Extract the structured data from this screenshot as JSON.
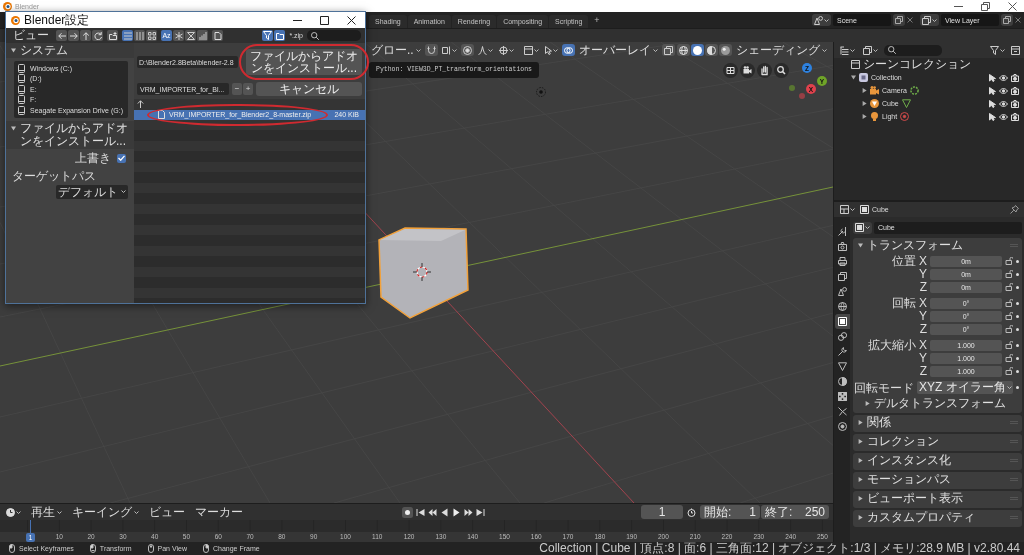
{
  "main_window": {
    "title": "Blender"
  },
  "top_bar": {
    "workspaces": [
      {
        "label": "Shading",
        "selected": false
      },
      {
        "label": "Animation",
        "selected": false
      },
      {
        "label": "Rendering",
        "selected": false
      },
      {
        "label": "Compositing",
        "selected": false
      },
      {
        "label": "Scripting",
        "selected": false
      }
    ],
    "add_workspace": "+",
    "scene": "Scene",
    "view_layer": "View Layer"
  },
  "viewport": {
    "header": {
      "orientation": "グロー..",
      "overlays": {
        "label": "オーバーレイ",
        "on": true
      },
      "shading": {
        "label": "シェーディング",
        "modes": [
          {
            "kind": "wireframe",
            "selected": false
          },
          {
            "kind": "solid",
            "selected": true
          },
          {
            "kind": "material",
            "selected": false
          },
          {
            "kind": "rendered",
            "selected": false
          }
        ]
      }
    },
    "tooltip": "Python: VIEW3D_PT_transform_orientations",
    "axes": [
      {
        "label": "Z",
        "color": "#2e82e0"
      },
      {
        "label": "Y",
        "color": "#6fa428"
      },
      {
        "label": "X",
        "color": "#e0414c"
      }
    ]
  },
  "dialog": {
    "title": "Blender設定",
    "menu": "ビュー",
    "view_modes": [
      {
        "kind": "vertical",
        "selected": true
      },
      {
        "kind": "horizontal",
        "selected": false
      },
      {
        "kind": "thumbnails",
        "selected": false
      }
    ],
    "sort_modes": [
      {
        "kind": "alpha",
        "label": "Az",
        "selected": true
      },
      {
        "kind": "extension",
        "selected": false
      },
      {
        "kind": "time",
        "selected": false
      },
      {
        "kind": "size",
        "selected": false
      }
    ],
    "filter": {
      "on": true,
      "text": "*.zip"
    },
    "sidebar": {
      "system": {
        "title": "システム",
        "expanded": true,
        "drives": [
          "Windows (C:)",
          "(D:)",
          "E:",
          "F:",
          "Seagate Expansion Drive (G:)"
        ]
      },
      "install": {
        "title": "ファイルからアドオンをインストール...",
        "expanded": true,
        "overwrite": {
          "label": "上書き",
          "checked": true
        },
        "target_path": {
          "label": "ターゲットパス",
          "value": "デフォルト"
        }
      }
    },
    "path": "D:\\Blender2.8Beta\\blender-2.8",
    "install_button": "ファイルからアドオンをインストール...",
    "filename": "VRM_IMPORTER_for_Bl...",
    "filename_steps": [
      "−",
      "+"
    ],
    "cancel_button": "キャンセル",
    "files": [
      {
        "kind": "parent",
        "selected": false
      },
      {
        "kind": "file",
        "name": "VRM_IMPORTER_for_Blender2_8-master.zip",
        "size": "240 KiB",
        "selected": true
      }
    ]
  },
  "outliner": {
    "tree": [
      {
        "label": "シーンコレクション",
        "kind": "scene_collection",
        "children": [
          {
            "label": "Collection",
            "kind": "collection",
            "expanded": true,
            "children": [
              {
                "label": "Camera",
                "kind": "camera",
                "expanded": false
              },
              {
                "label": "Cube",
                "kind": "mesh",
                "expanded": false
              },
              {
                "label": "Light",
                "kind": "light",
                "expanded": false
              }
            ]
          }
        ]
      }
    ]
  },
  "properties": {
    "object": "Cube",
    "name": "Cube",
    "tabs": [
      {
        "kind": "tool",
        "selected": false
      },
      {
        "kind": "render",
        "selected": false
      },
      {
        "kind": "output",
        "selected": false
      },
      {
        "kind": "view_layer",
        "selected": false
      },
      {
        "kind": "scene",
        "selected": false
      },
      {
        "kind": "world",
        "selected": false
      },
      {
        "kind": "object",
        "selected": true
      },
      {
        "kind": "constraints",
        "selected": false
      },
      {
        "kind": "modifiers",
        "selected": false
      },
      {
        "kind": "data",
        "selected": false
      },
      {
        "kind": "material",
        "selected": false
      },
      {
        "kind": "texture",
        "selected": false
      },
      {
        "kind": "particles",
        "selected": false
      },
      {
        "kind": "physics",
        "selected": false
      }
    ],
    "panels": [
      {
        "title": "トランスフォーム",
        "expanded": true,
        "groups": [
          {
            "rows": [
              {
                "kind": "number",
                "label": "位置 X",
                "value": "0m"
              },
              {
                "kind": "number",
                "label": "Y",
                "value": "0m"
              },
              {
                "kind": "number",
                "label": "Z",
                "value": "0m"
              }
            ]
          },
          {
            "rows": [
              {
                "kind": "number",
                "label": "回転 X",
                "value": "0°"
              },
              {
                "kind": "number",
                "label": "Y",
                "value": "0°"
              },
              {
                "kind": "number",
                "label": "Z",
                "value": "0°"
              }
            ]
          },
          {
            "rows": [
              {
                "kind": "number",
                "label": "拡大縮小 X",
                "value": "1.000"
              },
              {
                "kind": "number",
                "label": "Y",
                "value": "1.000"
              },
              {
                "kind": "number",
                "label": "Z",
                "value": "1.000"
              }
            ]
          },
          {
            "rows": [
              {
                "kind": "dropdown",
                "label": "回転モード",
                "value": "XYZ オイラー角"
              }
            ]
          }
        ],
        "subpanels": [
          {
            "title": "デルタトランスフォーム",
            "expanded": false
          }
        ]
      },
      {
        "title": "関係",
        "expanded": false
      },
      {
        "title": "コレクション",
        "expanded": false
      },
      {
        "title": "インスタンス化",
        "expanded": false
      },
      {
        "title": "モーションパス",
        "expanded": false
      },
      {
        "title": "ビューポート表示",
        "expanded": false
      },
      {
        "title": "カスタムプロパティ",
        "expanded": false
      }
    ]
  },
  "timeline": {
    "menus": [
      {
        "label": "再生",
        "kind": "dropdown"
      },
      {
        "label": "キーイング",
        "kind": "dropdown"
      },
      {
        "label": "ビュー",
        "kind": "menu"
      },
      {
        "label": "マーカー",
        "kind": "menu"
      }
    ],
    "frame": "1",
    "start": {
      "label": "開始:",
      "value": "1"
    },
    "end": {
      "label": "終了:",
      "value": "250"
    },
    "ruler": [
      "10",
      "20",
      "30",
      "40",
      "50",
      "60",
      "70",
      "80",
      "90",
      "100",
      "110",
      "120",
      "130",
      "140",
      "150",
      "160",
      "170",
      "180",
      "190",
      "200",
      "210",
      "220",
      "230",
      "240",
      "250"
    ],
    "cursor": "1"
  },
  "status_bar": {
    "hints": [
      {
        "kind": "left_click",
        "label": "Select Keyframes"
      },
      {
        "kind": "drag",
        "label": "Transform"
      },
      {
        "kind": "middle_click",
        "label": "Pan View"
      },
      {
        "kind": "right_click",
        "label": "Change Frame"
      }
    ],
    "stats": "Collection | Cube | 頂点:8 | 面:6 | 三角面:12 | オブジェクト:1/3 | メモリ:28.9 MB | v2.80.44"
  }
}
